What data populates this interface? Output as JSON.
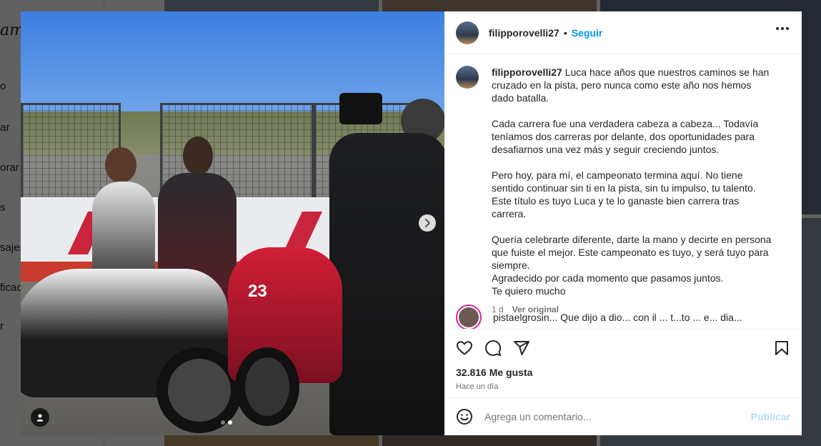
{
  "background": {
    "logo_partial": "am",
    "nav_partials": [
      "o",
      "ar",
      "orar",
      "s",
      "sajes",
      "ficac",
      "r"
    ]
  },
  "post": {
    "username": "filipporovelli27",
    "follow_label": "Seguir",
    "separator": "•",
    "caption_paragraphs": [
      [
        "Luca hace años que nuestros caminos se han cruzado en la pista, pero nunca como este año nos hemos dado batalla."
      ],
      [
        "Cada carrera fue una verdadera cabeza a cabeza... Todavía teníamos dos carreras por delante, dos oportunidades para desafiarnos una vez más y seguir creciendo juntos."
      ],
      [
        "Pero hoy, para mí, el campeonato termina aquí. No tiene sentido continuar sin ti en la pista, sin tu impulso, tu talento. Este título es tuyo Luca y te lo ganaste bien carrera tras carrera."
      ],
      [
        "Quería celebrarte diferente, darte la mano y decirte en persona que fuiste el mejor. Este campeonato es tuyo, y será tuyo para siempre.",
        "Agradecido por cada momento que pasamos juntos.",
        "Te quiero mucho"
      ]
    ],
    "caption_age": "1 d",
    "see_original": "Ver original",
    "next_comment_partial": "pistaelgrosin... Que dijo a dio... con il ... t...to ... e... dia...",
    "likes": "32.816 Me gusta",
    "posted_when": "Hace un día",
    "comment_placeholder": "Agrega un comentario...",
    "publish_label": "Publicar",
    "carousel": {
      "slide_count": 2,
      "active_index": 1
    }
  },
  "icons": {
    "more": "more-horizontal-icon",
    "like": "heart-icon",
    "comment": "comment-bubble-icon",
    "share": "paper-plane-icon",
    "save": "bookmark-icon",
    "emoji": "smiley-icon",
    "next": "chevron-right-icon",
    "tag": "user-tag-icon"
  },
  "colors": {
    "accent": "#0095f6",
    "publish_disabled": "#b3dbff",
    "secondary_text": "#737373"
  }
}
